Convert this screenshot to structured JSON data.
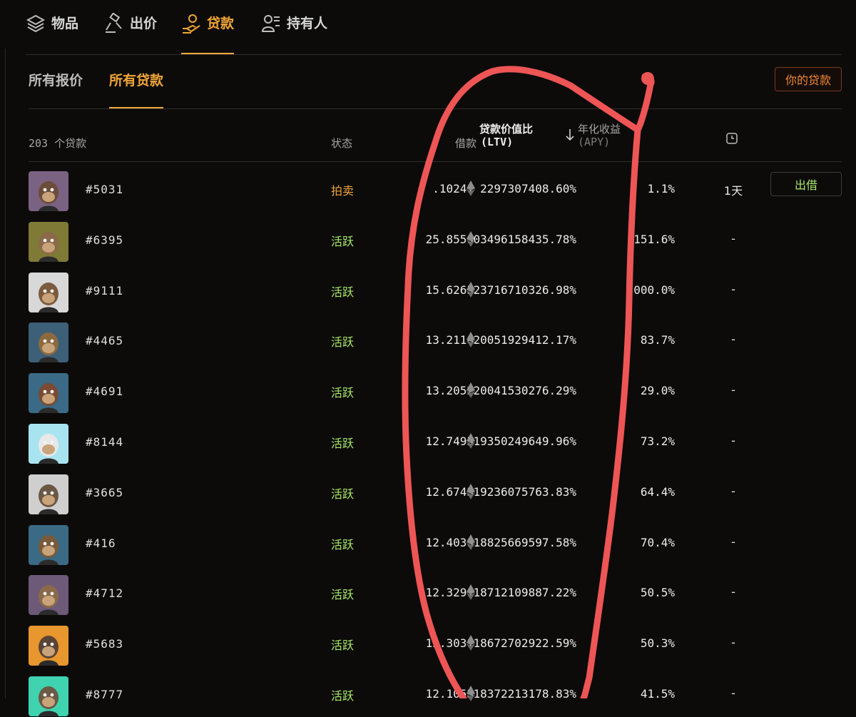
{
  "tabs": [
    {
      "label": "物品",
      "icon": "layers-icon",
      "active": false
    },
    {
      "label": "出价",
      "icon": "gavel-icon",
      "active": false
    },
    {
      "label": "贷款",
      "icon": "loan-hand-icon",
      "active": true
    },
    {
      "label": "持有人",
      "icon": "people-icon",
      "active": false
    }
  ],
  "subtabs": [
    {
      "label": "所有报价",
      "active": false
    },
    {
      "label": "所有贷款",
      "active": true
    }
  ],
  "your_loans_label": "你的贷款",
  "table": {
    "count_label": "203 个贷款",
    "headers": {
      "status": "状态",
      "loan": "借款",
      "ltv_line1": "贷款价值比",
      "ltv_line2": "(LTV)",
      "apy_line1": "年化收益",
      "apy_line2": "(APY)"
    },
    "sort_icon": "arrow-down-icon",
    "clock_icon": "clock-icon",
    "action_label": "出借",
    "rows": [
      {
        "id": "#5031",
        "status": "拍卖",
        "status_type": "auction",
        "loan": ".10241",
        "ltv": "2297307408.60%",
        "apy": "1.1%",
        "time": "1天",
        "action": true,
        "bg": "#7a6282",
        "fur": "#6b4d3a"
      },
      {
        "id": "#6395",
        "status": "活跃",
        "status_type": "active",
        "loan": "25.8559",
        "ltv": "03496158435.78%",
        "apy": "151.6%",
        "time": "-",
        "action": false,
        "bg": "#7f7a36",
        "fur": "#8a6a48"
      },
      {
        "id": "#9111",
        "status": "活跃",
        "status_type": "active",
        "loan": "15.6265",
        "ltv": "23716710326.98%",
        "apy": "000.0%",
        "time": "-",
        "action": false,
        "bg": "#d8d8d8",
        "fur": "#7b5a3e"
      },
      {
        "id": "#4465",
        "status": "活跃",
        "status_type": "active",
        "loan": "13.2118",
        "ltv": "20051929412.17%",
        "apy": "83.7%",
        "time": "-",
        "action": false,
        "bg": "#3d5f78",
        "fur": "#8c6a3e"
      },
      {
        "id": "#4691",
        "status": "活跃",
        "status_type": "active",
        "loan": "13.2052",
        "ltv": "20041530276.29%",
        "apy": "29.0%",
        "time": "-",
        "action": false,
        "bg": "#3a6a86",
        "fur": "#7a4a34"
      },
      {
        "id": "#8144",
        "status": "活跃",
        "status_type": "active",
        "loan": "12.7495",
        "ltv": "19350249649.96%",
        "apy": "73.2%",
        "time": "-",
        "action": false,
        "bg": "#a8e4ef",
        "fur": "#e8e8e8"
      },
      {
        "id": "#3665",
        "status": "活跃",
        "status_type": "active",
        "loan": "12.6743",
        "ltv": "19236075763.83%",
        "apy": "64.4%",
        "time": "-",
        "action": false,
        "bg": "#cfcfcf",
        "fur": "#6b5844"
      },
      {
        "id": "#416",
        "status": "活跃",
        "status_type": "active",
        "loan": "12.4039",
        "ltv": "18825669597.58%",
        "apy": "70.4%",
        "time": "-",
        "action": false,
        "bg": "#3b6a84",
        "fur": "#7a5a3a"
      },
      {
        "id": "#4712",
        "status": "活跃",
        "status_type": "active",
        "loan": "12.3291",
        "ltv": "18712109887.22%",
        "apy": "50.5%",
        "time": "-",
        "action": false,
        "bg": "#6c5a78",
        "fur": "#8a6a4a"
      },
      {
        "id": "#5683",
        "status": "活跃",
        "status_type": "active",
        "loan": "12.3031",
        "ltv": "18672702922.59%",
        "apy": "50.3%",
        "time": "-",
        "action": false,
        "bg": "#e8962e",
        "fur": "#5a4436"
      },
      {
        "id": "#8777",
        "status": "活跃",
        "status_type": "active",
        "loan": "12.1053",
        "ltv": "18372213178.83%",
        "apy": "41.5%",
        "time": "-",
        "action": false,
        "bg": "#3fd3b0",
        "fur": "#6b5a44"
      }
    ]
  },
  "colors": {
    "accent": "#f1a53a",
    "active_status": "#a8e86a",
    "annotation": "#ee5555"
  }
}
